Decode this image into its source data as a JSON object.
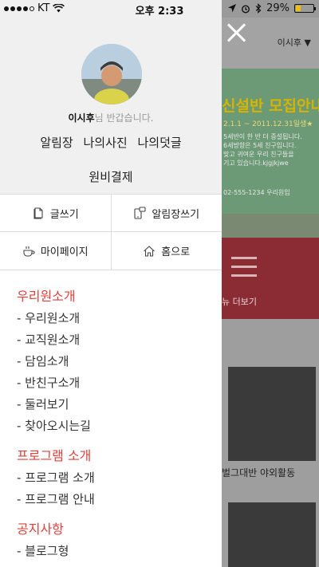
{
  "status_bar": {
    "carrier": "KT",
    "time": "오후 2:33",
    "battery": "29%",
    "battery_level": 0.29
  },
  "background": {
    "user_menu": "이시후 ▼",
    "banner_title": "신설반 모집안내",
    "banner_date": "2.1.1 ~ 2011.12.31일생★",
    "banner_lines": [
      "5세반이 한 반 더 증설됩니다.",
      "6세방향은 5세 친구입니다.",
      "맞고 귀여운 우리 친구들을",
      "기고 있습니다.kjgjkjwe"
    ],
    "banner_phone": "02-555-1234 우리원입",
    "more_label": "뉴 더보기",
    "photo_caption": "벌그대반 야외활동"
  },
  "drawer": {
    "greeting_name": "이시후",
    "greeting_suffix": "님 반갑습니다.",
    "links": [
      "알림장",
      "나의사진",
      "나의덧글"
    ],
    "payment": "원비결제",
    "quick": {
      "write": "글쓰기",
      "notice_write": "알림장쓰기",
      "mypage": "마이페이지",
      "home": "홈으로"
    },
    "menu": [
      {
        "heading": "우리원소개",
        "items": [
          "- 우리원소개",
          "- 교직원소개",
          "- 담임소개",
          "- 반친구소개",
          "- 둘러보기",
          "- 찾아오시는길"
        ]
      },
      {
        "heading": "프로그램 소개",
        "items": [
          "- 프로그램 소개",
          "- 프로그램 안내"
        ]
      },
      {
        "heading": "공지사항",
        "items": [
          "- 블로그형"
        ]
      }
    ]
  },
  "colors": {
    "menu_heading": "#e0403a",
    "profile_bg": "#f0f0f0",
    "battery_fill": "#f2c200"
  }
}
